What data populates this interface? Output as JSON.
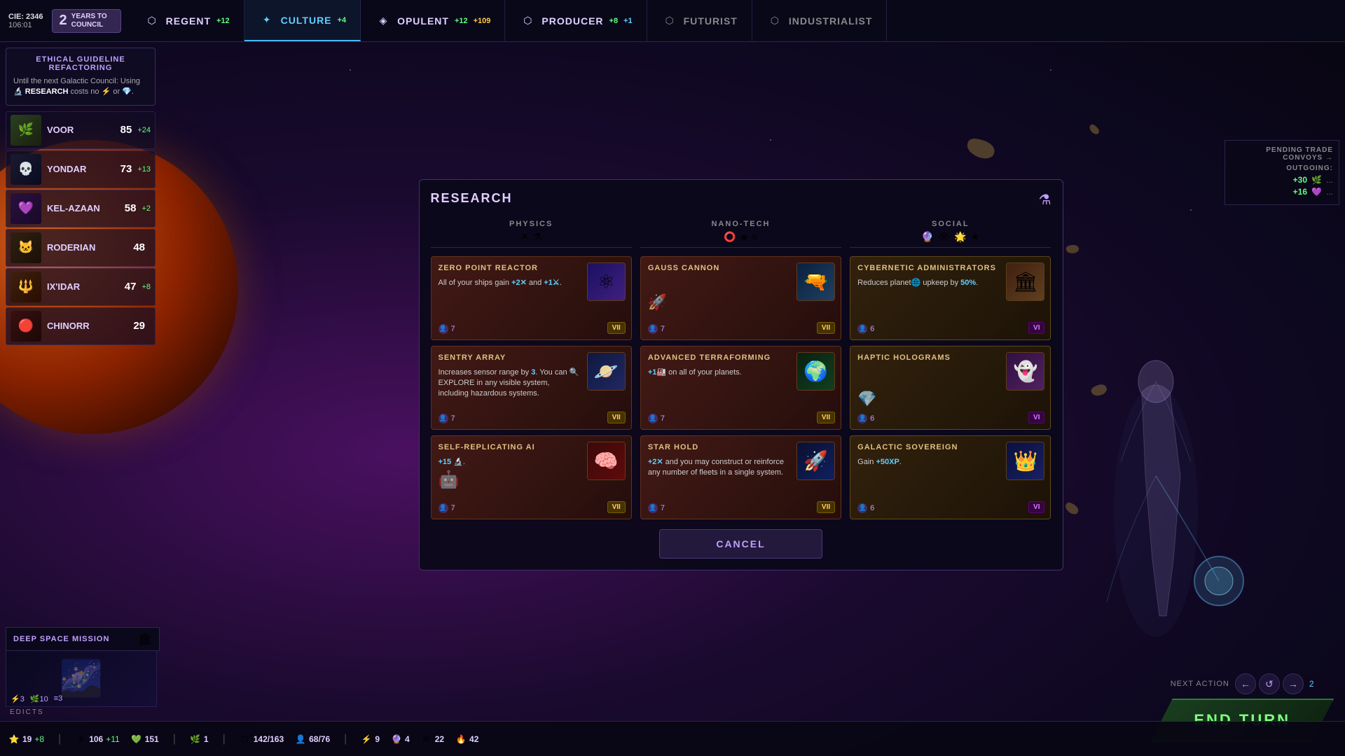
{
  "game": {
    "cie": "CIE: 2346",
    "cie_sub": "106:01",
    "years_label": "2",
    "years_sub": "YEARS TO COUNCIL"
  },
  "nav": {
    "items": [
      {
        "id": "regent",
        "label": "REGENT",
        "bonus": "+12",
        "icon": "⬡",
        "active": false
      },
      {
        "id": "culture",
        "label": "CULTURE",
        "bonus": "+4",
        "icon": "✦",
        "active": true
      },
      {
        "id": "opulent",
        "label": "OPULENT",
        "bonus": "+12 / +109",
        "icon": "◈",
        "active": false
      },
      {
        "id": "producer",
        "label": "PRODUCER",
        "bonus": "+8 / +1",
        "icon": "⬡",
        "active": false
      },
      {
        "id": "futurist",
        "label": "FUTURIST",
        "bonus": "",
        "icon": "⬡",
        "active": false,
        "dim": true
      },
      {
        "id": "industrialist",
        "label": "INDUSTRIALIST",
        "bonus": "",
        "icon": "⬡",
        "active": false,
        "dim": true
      }
    ]
  },
  "ethical_notice": {
    "title": "ETHICAL GUIDELINE REFACTORING",
    "text": "Until the next Galactic Council: Using 🔬 RESEARCH costs no ⚡ or 💎."
  },
  "leaders": [
    {
      "name": "VOOR",
      "score": 85,
      "delta": "+24",
      "icon": "🌿"
    },
    {
      "name": "YONDAR",
      "score": 73,
      "delta": "+13",
      "icon": "💀"
    },
    {
      "name": "KEL-AZAAN",
      "score": 58,
      "delta": "+2",
      "icon": "💜"
    },
    {
      "name": "RODERIAN",
      "score": 48,
      "delta": "",
      "icon": "🐱"
    },
    {
      "name": "IX'IDAR",
      "score": 47,
      "delta": "+8",
      "icon": "🔱"
    },
    {
      "name": "CHINORR",
      "score": 29,
      "delta": "",
      "icon": "🔴"
    }
  ],
  "modal": {
    "title": "RESEARCH",
    "columns": [
      {
        "id": "physics",
        "label": "PHYSICS",
        "icons": [
          "✕",
          "⚗"
        ],
        "cards": [
          {
            "id": "zero-point-reactor",
            "title": "ZERO POINT REACTOR",
            "desc": "All of your ships gain +2✕ and +1⚔.",
            "tier": "VII",
            "tier_type": "gold",
            "cost": 7,
            "img_class": "physics-img",
            "img_icon": "⚛"
          },
          {
            "id": "sentry-array",
            "title": "SENTRY ARRAY",
            "desc": "Increases sensor range by 3. You can 🔍 EXPLORE in any visible system, including hazardous systems.",
            "tier": "VII",
            "tier_type": "gold",
            "cost": 7,
            "img_class": "sentry-img",
            "img_icon": "🪐"
          },
          {
            "id": "self-replicating-ai",
            "title": "SELF-REPLICATING AI",
            "desc": "+15 🔬.",
            "tier": "VII",
            "tier_type": "gold",
            "cost": 7,
            "img_class": "ai-img",
            "img_icon": "🧠"
          }
        ]
      },
      {
        "id": "nanotech",
        "label": "NANO-TECH",
        "icons": [
          "⭕",
          "◈",
          "≡"
        ],
        "cards": [
          {
            "id": "gauss-cannon",
            "title": "GAUSS CANNON",
            "desc": "",
            "tier": "VII",
            "tier_type": "gold",
            "cost": 7,
            "img_class": "cannon-img",
            "img_icon": "🔫"
          },
          {
            "id": "advanced-terraforming",
            "title": "ADVANCED TERRAFORMING",
            "desc": "+1🏭 on all of your planets.",
            "tier": "VII",
            "tier_type": "gold",
            "cost": 7,
            "img_class": "terra-img",
            "img_icon": "🌍"
          },
          {
            "id": "star-hold",
            "title": "STAR HOLD",
            "desc": "+2✕ and you may construct or reinforce any number of fleets in a single system.",
            "tier": "VII",
            "tier_type": "gold",
            "cost": 7,
            "img_class": "starhold-img",
            "img_icon": "🚀"
          }
        ]
      },
      {
        "id": "social",
        "label": "SOCIAL",
        "icons": [
          "🔮",
          "👁",
          "🌟",
          "★"
        ],
        "cards": [
          {
            "id": "cybernetic-administrators",
            "title": "CYBERNETIC ADMINISTRATORS",
            "desc": "Reduces planet🌐 upkeep by 50%.",
            "tier": "VI",
            "tier_type": "purple",
            "cost": 6,
            "img_class": "cyber-img",
            "img_icon": "🏛"
          },
          {
            "id": "haptic-holograms",
            "title": "HAPTIC HOLOGRAMS",
            "desc": "",
            "tier": "VI",
            "tier_type": "purple",
            "cost": 6,
            "img_class": "haptic-img",
            "img_icon": "👻"
          },
          {
            "id": "galactic-sovereign",
            "title": "GALACTIC SOVEREIGN",
            "desc": "Gain +50 XP.",
            "tier": "VI",
            "tier_type": "purple",
            "cost": 6,
            "img_class": "galactic-img",
            "img_icon": "👑"
          }
        ]
      }
    ],
    "cancel_label": "CANCEL"
  },
  "trade": {
    "title": "PENDING TRADE CONVOYS →",
    "outgoing_label": "OUTGOING:",
    "rows": [
      {
        "val": "+30",
        "icon": "🌿",
        "dots": "..."
      },
      {
        "val": "+16",
        "icon": "💜",
        "dots": "..."
      }
    ]
  },
  "deep_space": {
    "title": "DEEP SPACE MISSION",
    "icon": "🏛",
    "stats": [
      "3 ⚡",
      "10 🌿",
      "3 ≡"
    ],
    "edicts_label": "EDICTS"
  },
  "bottom_bar": {
    "stats": [
      {
        "icon": "⭐",
        "val": "19",
        "bonus": "+8"
      },
      {
        "icon": "☀",
        "val": "106",
        "bonus": "+11"
      },
      {
        "icon": "💚",
        "val": "151",
        "bonus": ""
      },
      {
        "icon": "🌿",
        "val": "1",
        "bonus": ""
      },
      {
        "icon": "⬡",
        "val": "142/163",
        "bonus": ""
      },
      {
        "icon": "👤",
        "val": "68/76",
        "bonus": ""
      },
      {
        "icon": "⚡",
        "val": "9",
        "bonus": ""
      },
      {
        "icon": "🔮",
        "val": "4",
        "bonus": ""
      },
      {
        "icon": "✉",
        "val": "22",
        "bonus": ""
      },
      {
        "icon": "🔥",
        "val": "42",
        "bonus": ""
      }
    ]
  },
  "end_turn": {
    "next_action_label": "NEXT ACTION",
    "val": "2",
    "end_turn_label": "END TURN"
  }
}
